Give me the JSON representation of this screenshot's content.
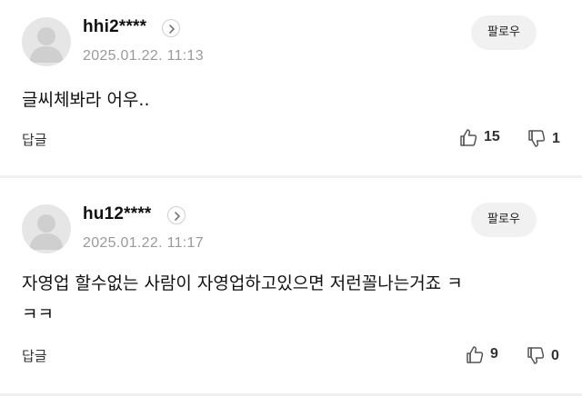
{
  "comments": [
    {
      "username": "hhi2****",
      "date": "2025.01.22. 11:13",
      "follow_label": "팔로우",
      "body_lines": [
        "글씨체봐라 어우.."
      ],
      "reply_label": "답글",
      "likes": "15",
      "dislikes": "1"
    },
    {
      "username": "hu12****",
      "date": "2025.01.22. 11:17",
      "follow_label": "팔로우",
      "body_lines": [
        "자영업 할수없는 사람이 자영업하고있으면 저런꼴나는거죠 ㅋ",
        "ㅋㅋ"
      ],
      "reply_label": "답글",
      "likes": "9",
      "dislikes": "0"
    }
  ],
  "icons": {
    "avatar": "default-avatar-icon",
    "chevron": "chevron-right-icon",
    "like": "thumbs-up-icon",
    "dislike": "thumbs-down-icon"
  }
}
